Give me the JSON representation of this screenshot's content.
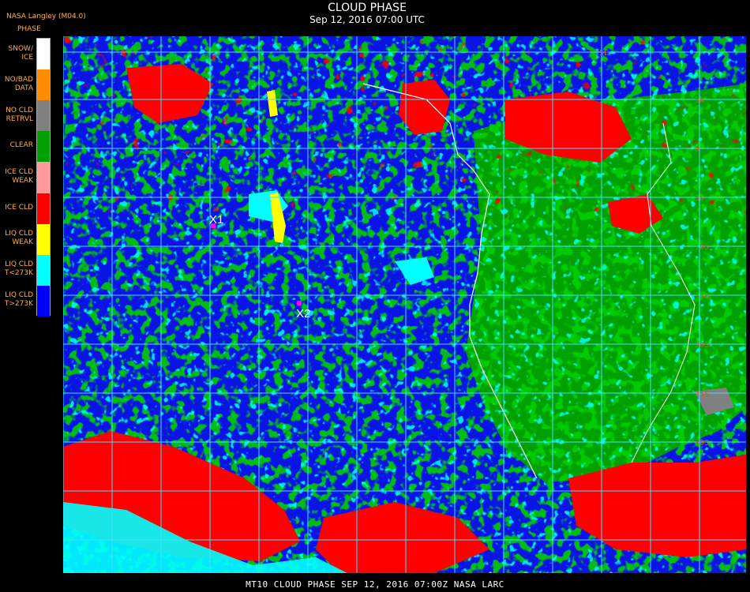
{
  "title": "CLOUD PHASE",
  "subtitle": "Sep 12, 2016 07:00 UTC",
  "footer": "MT10  CLOUD PHASE   SEP 12, 2016 07:00Z   NASA LARC",
  "legend": {
    "org": "NASA Langley (M04.0)",
    "heading": "PHASE",
    "items": [
      {
        "label": "SNOW/\nICE",
        "color": "#ffffff"
      },
      {
        "label": "NO/BAD\nDATA",
        "color": "#ff8c00"
      },
      {
        "label": "NO CLD\nRETRVL",
        "color": "#808080"
      },
      {
        "label": "CLEAR",
        "color": "#00a000"
      },
      {
        "label": "ICE CLD\nWEAK",
        "color": "#ff9a9a"
      },
      {
        "label": "ICE CLD",
        "color": "#ff0000"
      },
      {
        "label": "LIQ CLD\nWEAK",
        "color": "#ffff00"
      },
      {
        "label": "LIQ CLD\nT<273K",
        "color": "#00ffff"
      },
      {
        "label": "LIQ CLD\nT>273K",
        "color": "#0000ff"
      }
    ]
  },
  "markers": [
    {
      "label": "X1",
      "color": "#ff00ff"
    },
    {
      "label": "X2",
      "color": "#ff00ff"
    }
  ],
  "latitude_labels": [
    "25E",
    "5N",
    "0",
    "5S",
    "10S",
    "15S",
    "20S",
    "25S",
    "30S"
  ],
  "colors": {
    "grid": "#40e0ff",
    "coast": "#ffffff",
    "lat_label": "#d05a20",
    "background": "#000000"
  }
}
